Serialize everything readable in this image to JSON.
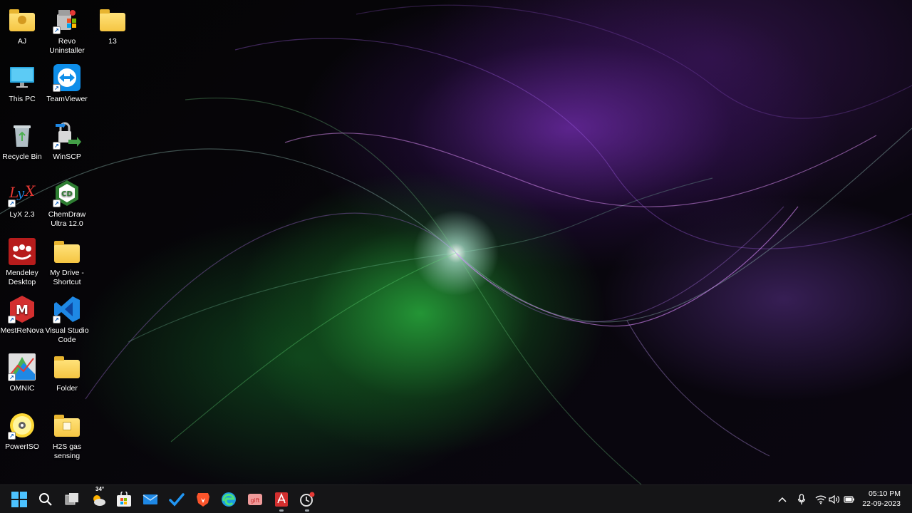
{
  "desktop": {
    "icons": [
      {
        "label": "AJ"
      },
      {
        "label": "Revo Uninstaller"
      },
      {
        "label": "13"
      },
      {
        "label": "This PC"
      },
      {
        "label": "TeamViewer"
      },
      {
        "label": "Recycle Bin"
      },
      {
        "label": "WinSCP"
      },
      {
        "label": "LyX 2.3"
      },
      {
        "label": "ChemDraw Ultra 12.0"
      },
      {
        "label": "Mendeley Desktop"
      },
      {
        "label": "My Drive - Shortcut"
      },
      {
        "label": "MestReNova"
      },
      {
        "label": "Visual Studio Code"
      },
      {
        "label": "OMNIC"
      },
      {
        "label": "Folder"
      },
      {
        "label": "PowerISO"
      },
      {
        "label": "H2S gas sensing"
      }
    ]
  },
  "taskbar": {
    "weather_temp": "34°",
    "apps": [
      "start-icon",
      "search-icon",
      "task-view-icon",
      "weather-icon",
      "store-icon",
      "mail-icon",
      "todo-icon",
      "brave-icon",
      "edge-icon",
      "photo-app-icon",
      "acrobat-icon",
      "snipping-icon"
    ],
    "clock": {
      "time": "05:10 PM",
      "date": "22-09-2023"
    }
  },
  "colors": {
    "taskbar_bg": "#161618",
    "accent": "#0078d4"
  }
}
